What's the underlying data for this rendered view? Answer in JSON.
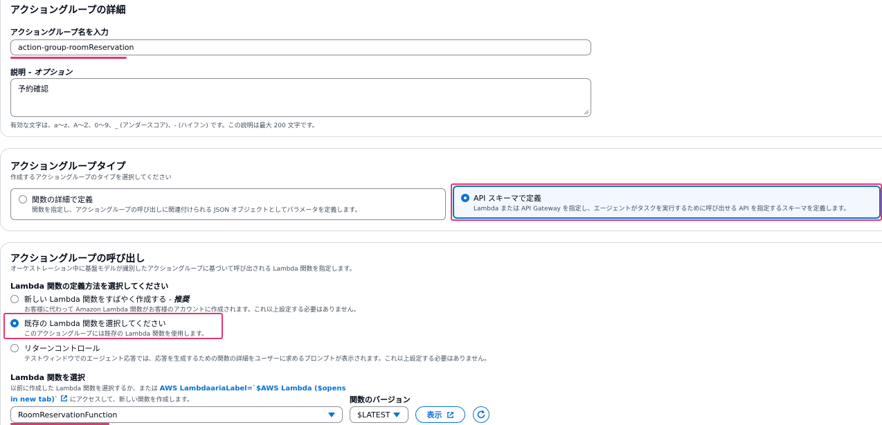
{
  "details": {
    "title": "アクショングループの詳細",
    "name_label": "アクショングループ名を入力",
    "name_value": "action-group-roomReservation",
    "desc_label": "説明 - ",
    "desc_label_optional": "オプション",
    "desc_value": "予約確認",
    "hint": "有効な文字は、a〜z、A〜Z、0〜9、_ (アンダースコア)、- (ハイフン) です。この説明は最大 200 文字です。"
  },
  "type_section": {
    "title": "アクショングループタイプ",
    "subtitle": "作成するアクショングループのタイプを選択してください",
    "options": [
      {
        "title": "関数の詳細で定義",
        "desc": "関数を指定し、アクショングループの呼び出しに関連付けられる JSON オブジェクトとしてパラメータを定義します。",
        "selected": false
      },
      {
        "title": "API スキーマで定義",
        "desc": "Lambda または API Gateway を指定し、エージェントがタスクを実行するために呼び出せる API を指定するスキーマを定義します。",
        "selected": true
      }
    ]
  },
  "invocation": {
    "title": "アクショングループの呼び出し",
    "subtitle": "オーケストレーション中に基盤モデルが識別したアクショングループに基づいて呼び出される Lambda 関数を指定します。",
    "method_label": "Lambda 関数の定義方法を選択してください",
    "options": [
      {
        "title": "新しい Lambda 関数をすばやく作成する - ",
        "title_em": "推奨",
        "desc": "お客様に代わって Amazon Lambda 関数がお客様のアカウントに作成されます。これ以上設定する必要はありません。",
        "selected": false
      },
      {
        "title": "既存の Lambda 関数を選択してください",
        "title_em": "",
        "desc": "このアクショングループには既存の Lambda 関数を使用します。",
        "selected": true
      },
      {
        "title": "リターンコントロール",
        "title_em": "",
        "desc": "テストウィンドウでのエージェント応答では、応答を生成するための関数の詳細をユーザーに求めるプロンプトが表示されます。これ以上設定する必要はありません。",
        "selected": false
      }
    ],
    "select_label": "Lambda 関数を選択",
    "select_desc_prefix": "以前に作成した Lambda 関数を選択するか、または ",
    "select_desc_link_1": "AWS LambdaariaLabel=`$AWS Lambda ($opens",
    "select_desc_link_2": "in new tab)`",
    "select_desc_suffix": " にアクセスして、新しい関数を作成します。",
    "function_value": "RoomReservationFunction",
    "version_label": "関数のバージョン",
    "version_value": "$LATEST",
    "view_button": "表示"
  },
  "colors": {
    "accent": "#0972d3",
    "highlight": "#e8356e",
    "text": "#000716",
    "muted": "#414d5c"
  }
}
